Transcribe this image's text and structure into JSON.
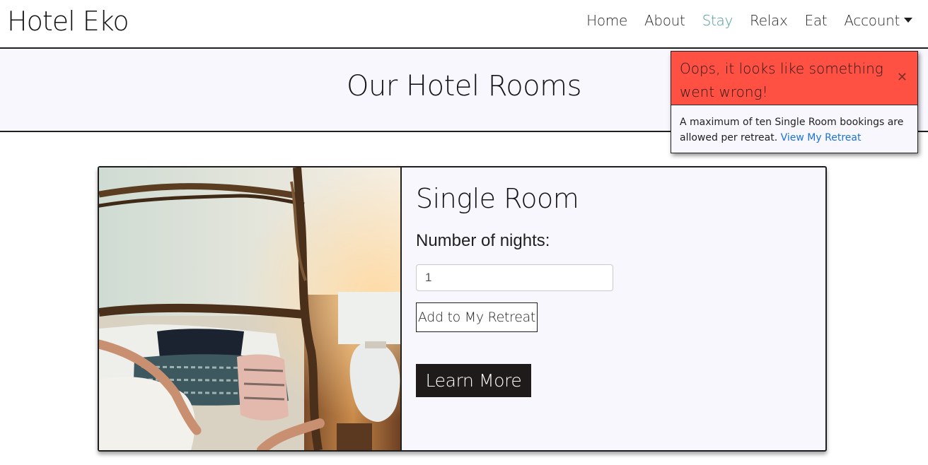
{
  "navbar": {
    "brand": "Hotel Eko",
    "links": [
      {
        "label": "Home"
      },
      {
        "label": "About"
      },
      {
        "label": "Stay"
      },
      {
        "label": "Relax"
      },
      {
        "label": "Eat"
      },
      {
        "label": "Account"
      }
    ],
    "active_link": "Stay",
    "active_color": "#4b9b9b"
  },
  "header": {
    "title": "Our Hotel Rooms"
  },
  "toast": {
    "title": "Oops, it looks like something went wrong!",
    "close_icon": "close-icon",
    "message": "A maximum of ten Single Room bookings are allowed per retreat.",
    "link_label": "View My Retreat",
    "header_color": "#ff5044"
  },
  "room": {
    "name": "Single Room",
    "nights_label": "Number of nights:",
    "nights_value": "1",
    "add_label": "Add to My Retreat",
    "learn_label": "Learn More"
  }
}
